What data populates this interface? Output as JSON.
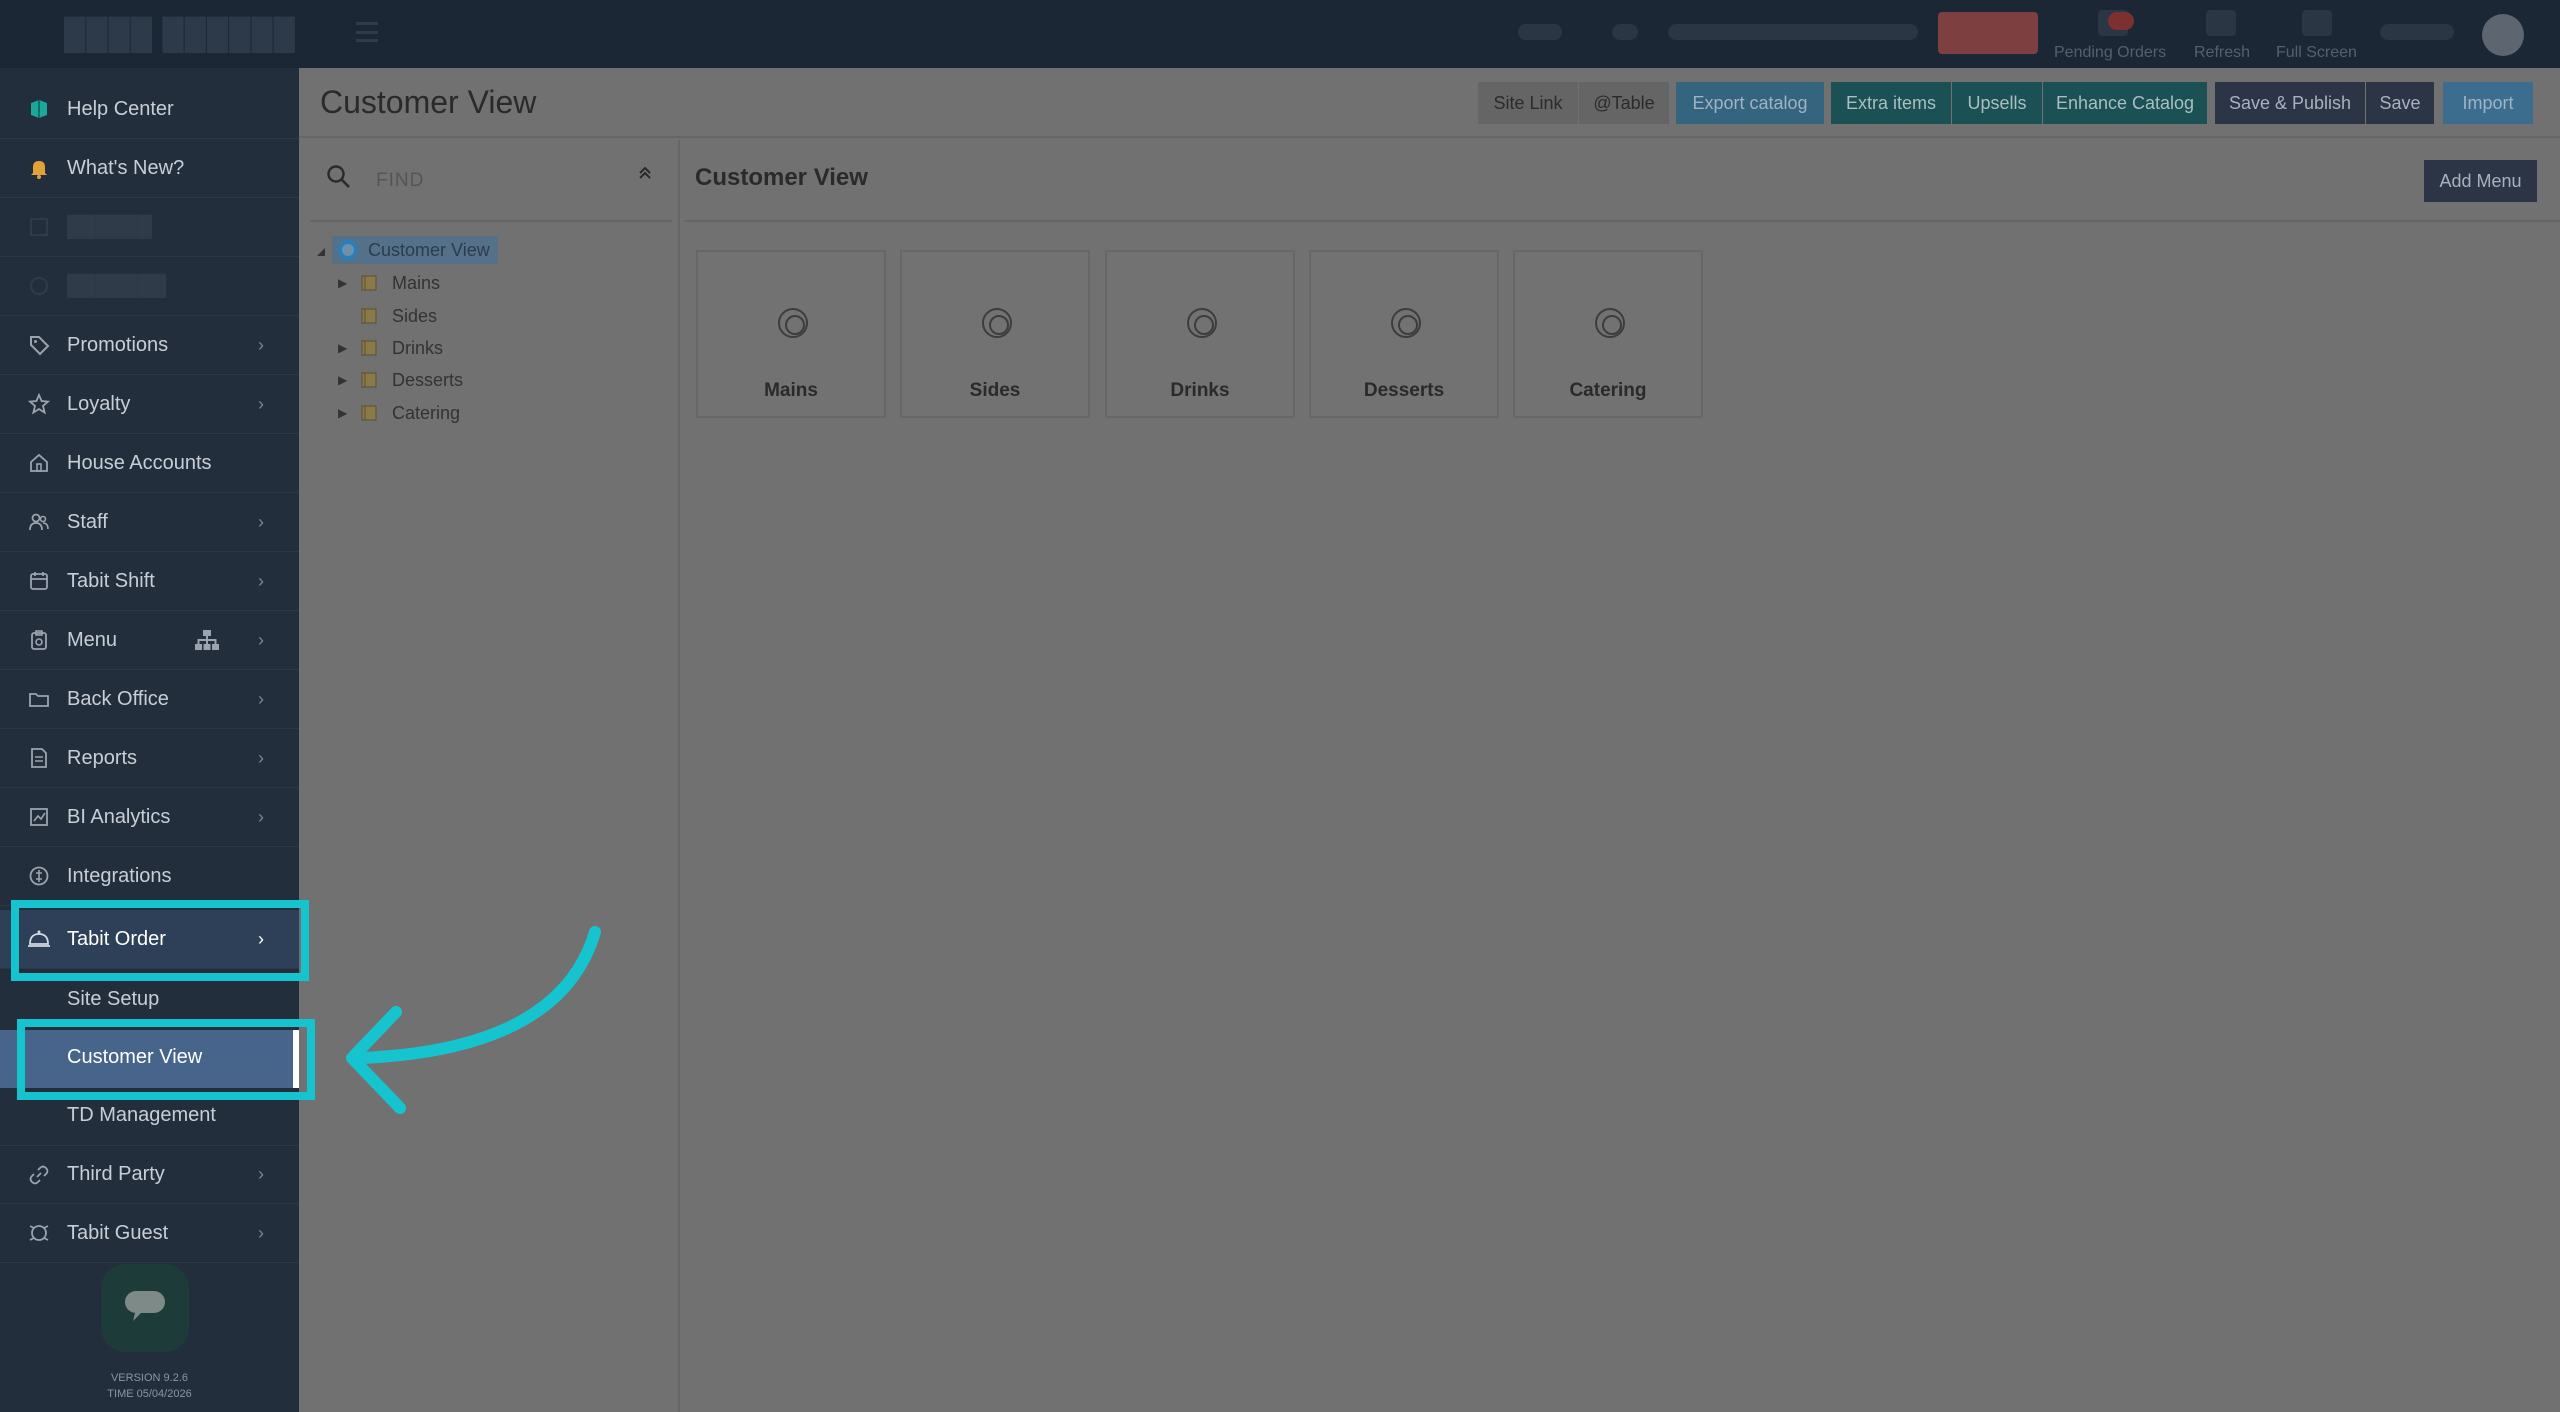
{
  "topbar": {
    "labels": [
      "Pending Orders",
      "Refresh",
      "Full Screen"
    ]
  },
  "sidebar": {
    "items": [
      {
        "label": "Help Center",
        "icon": "help-center-icon"
      },
      {
        "label": "What's New?",
        "icon": "bell-icon"
      },
      {
        "label": "",
        "icon": "blurred-icon"
      },
      {
        "label": "",
        "icon": "blurred-icon"
      },
      {
        "label": "Promotions",
        "icon": "tag-icon"
      },
      {
        "label": "Loyalty",
        "icon": "star-icon"
      },
      {
        "label": "House Accounts",
        "icon": "house-icon"
      },
      {
        "label": "Staff",
        "icon": "users-icon"
      },
      {
        "label": "Tabit Shift",
        "icon": "calendar-icon"
      },
      {
        "label": "Menu",
        "icon": "clipboard-icon"
      },
      {
        "label": "Back Office",
        "icon": "folder-icon"
      },
      {
        "label": "Reports",
        "icon": "report-icon"
      },
      {
        "label": "BI Analytics",
        "icon": "chart-icon"
      },
      {
        "label": "Integrations",
        "icon": "integrations-icon"
      },
      {
        "label": "Tabit Order",
        "icon": "cloche-icon"
      }
    ],
    "sub_items": [
      {
        "label": "Site Setup"
      },
      {
        "label": "Customer View"
      },
      {
        "label": "TD Management"
      }
    ],
    "bottom_items": [
      {
        "label": "Third Party",
        "icon": "link-icon"
      },
      {
        "label": "Tabit Guest",
        "icon": "guest-icon"
      }
    ],
    "version": "VERSION 9.2.6",
    "time": "TIME 05/04/2026"
  },
  "header": {
    "title": "Customer View",
    "buttons": [
      "Site Link",
      "@Table",
      "Export catalog",
      "Extra items",
      "Upsells",
      "Enhance Catalog",
      "Save & Publish",
      "Save",
      "Import"
    ]
  },
  "tree": {
    "search_placeholder": "FIND",
    "root": "Customer View",
    "children": [
      "Mains",
      "Sides",
      "Drinks",
      "Desserts",
      "Catering"
    ]
  },
  "content": {
    "title": "Customer View",
    "add_button": "Add Menu",
    "cards": [
      "Mains",
      "Sides",
      "Drinks",
      "Desserts",
      "Catering"
    ]
  },
  "colors": {
    "highlight": "#16c4cf",
    "sidebar_bg": "#232e3c",
    "overlay_bg": "#717171"
  }
}
